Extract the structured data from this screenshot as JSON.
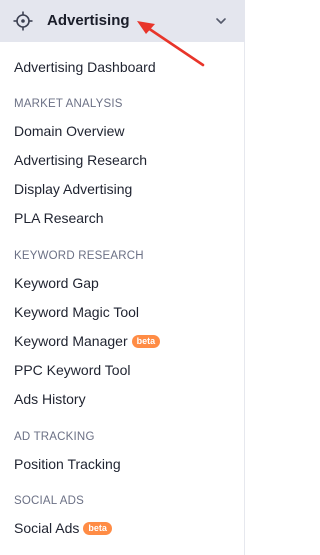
{
  "header": {
    "title": "Advertising",
    "icon": "crosshair-icon",
    "chevron": "chevron-down-icon",
    "arrow_color": "#e8352a"
  },
  "menu": {
    "dashboard": "Advertising Dashboard",
    "sections": [
      {
        "title": "MARKET ANALYSIS",
        "items": [
          {
            "label": "Domain Overview"
          },
          {
            "label": "Advertising Research"
          },
          {
            "label": "Display Advertising"
          },
          {
            "label": "PLA Research"
          }
        ]
      },
      {
        "title": "KEYWORD RESEARCH",
        "items": [
          {
            "label": "Keyword Gap"
          },
          {
            "label": "Keyword Magic Tool"
          },
          {
            "label": "Keyword Manager",
            "badge": "beta"
          },
          {
            "label": "PPC Keyword Tool"
          },
          {
            "label": "Ads History"
          }
        ]
      },
      {
        "title": "AD TRACKING",
        "items": [
          {
            "label": "Position Tracking"
          }
        ]
      },
      {
        "title": "SOCIAL ADS",
        "items": [
          {
            "label": "Social Ads",
            "badge": "beta"
          }
        ]
      }
    ]
  },
  "colors": {
    "header_bg": "#e4e6ee",
    "badge_bg": "#ff8c45",
    "section_text": "#6b7085",
    "item_text": "#1f2330"
  }
}
